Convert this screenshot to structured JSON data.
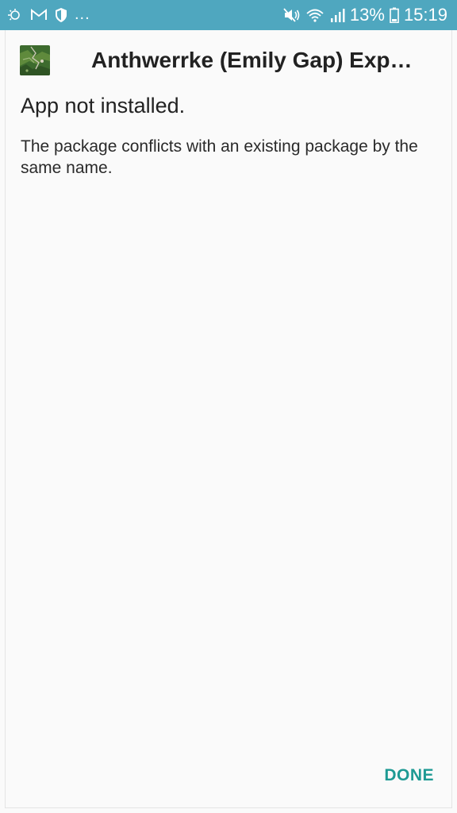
{
  "status_bar": {
    "background_color": "#4fa7bf",
    "left_icons": [
      "sync-icon",
      "gmail-icon",
      "shield-icon"
    ],
    "overflow_dots": "...",
    "right_icons": [
      "mute-icon",
      "wifi-icon",
      "signal-icon"
    ],
    "battery_percent": "13%",
    "battery_icon": "battery-icon",
    "time": "15:19"
  },
  "dialog": {
    "app_icon": "app-icon",
    "app_name": "Anthwerrke (Emily Gap) Exp…",
    "status_title": "App not installed.",
    "status_message": "The package conflicts with an existing package by the same name.",
    "done_label": "DONE",
    "accent_color": "#1e9a94"
  }
}
